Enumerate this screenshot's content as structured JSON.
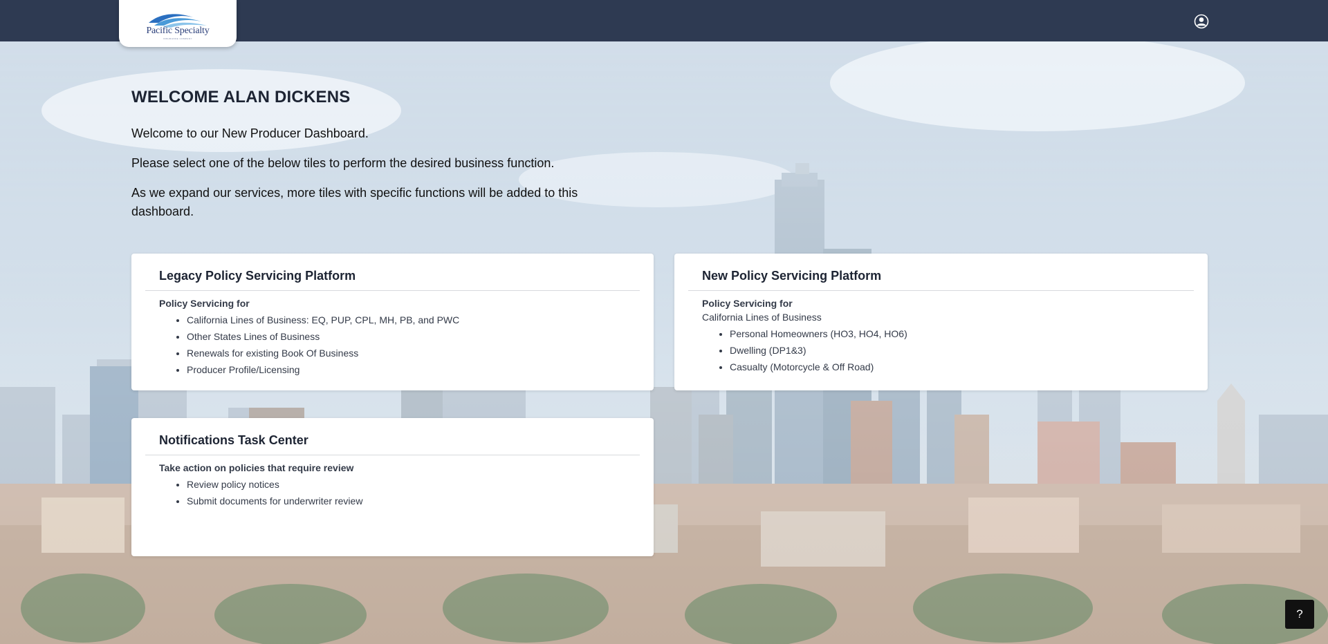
{
  "header": {
    "logo_text": "Pacific Specialty",
    "logo_subtext": "INSURANCE COMPANY",
    "user_icon": "user-circle-icon"
  },
  "welcome": {
    "title": "WELCOME ALAN DICKENS",
    "line1": "Welcome to our New Producer Dashboard.",
    "line2": "Please select one of the below tiles to perform the desired business function.",
    "line3": "As we expand our services, more tiles with specific functions will be added to this dashboard."
  },
  "tiles": {
    "legacy": {
      "title": "Legacy Policy Servicing Platform",
      "subtitle": "Policy Servicing for",
      "items": [
        "California Lines of Business: EQ, PUP, CPL, MH, PB, and PWC",
        "Other States Lines of Business",
        "Renewals for existing Book Of Business",
        "Producer Profile/Licensing"
      ]
    },
    "new": {
      "title": "New Policy Servicing Platform",
      "subtitle": "Policy Servicing for",
      "line": "California Lines of Business",
      "items": [
        "Personal Homeowners (HO3, HO4, HO6)",
        "Dwelling (DP1&3)",
        "Casualty (Motorcycle & Off Road)"
      ]
    },
    "notifications": {
      "title": "Notifications Task Center",
      "subtitle": "Take action on policies that require review",
      "items": [
        "Review policy notices",
        "Submit documents for underwriter review"
      ]
    }
  },
  "help": {
    "label": "?"
  },
  "colors": {
    "header_bg": "#2e3a52",
    "logo_blue": "#2b3f7a",
    "tile_bg": "#ffffff",
    "help_bg": "#111111"
  }
}
